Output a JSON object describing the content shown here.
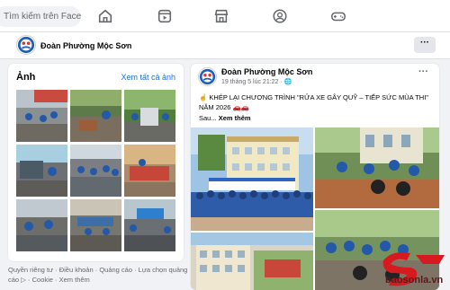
{
  "nav": {
    "search_placeholder": "Tìm kiếm trên Facebook",
    "icons": [
      "home-icon",
      "video-icon",
      "marketplace-icon",
      "groups-icon",
      "gaming-icon"
    ]
  },
  "page": {
    "name": "Đoàn Phường Mộc Sơn",
    "more_label": "···"
  },
  "photos": {
    "title": "Ảnh",
    "see_all": "Xem tất cả ảnh"
  },
  "footer": {
    "links": "Quyền riêng tư · Điều khoản · Quảng cáo · Lựa chọn quảng cáo ▷ · Cookie · Xem thêm"
  },
  "post": {
    "author": "Đoàn Phường Mộc Sơn",
    "timestamp": "19 tháng 5 lúc 21:22 · 🌐",
    "more_label": "···",
    "text": "☝ KHÉP LẠI CHƯƠNG TRÌNH \"RỬA XE GÂY QUỸ – TIẾP SỨC MÙA THI\" NĂM 2026 🚗🚗",
    "see_more_prefix": "Sau...",
    "see_more": "Xem thêm"
  },
  "watermark": {
    "text": "baosonla.vn"
  },
  "colors": {
    "link": "#216fdb",
    "background": "#f0f2f5",
    "watermark_red": "#d71920"
  }
}
